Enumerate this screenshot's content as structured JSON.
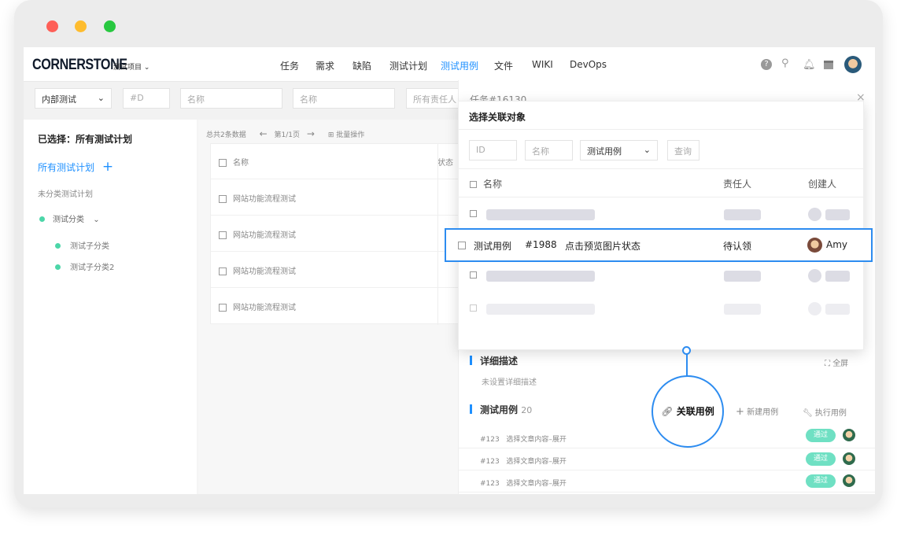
{
  "window": {
    "buttons": [
      "close",
      "minimize",
      "maximize"
    ]
  },
  "nav": {
    "logo": "CORNERSTONE",
    "project": "测试项目",
    "items": [
      "任务",
      "需求",
      "缺陷",
      "测试计划",
      "测试用例",
      "文件",
      "WIKI",
      "DevOps"
    ],
    "active": "测试用例",
    "icons": [
      "help-icon",
      "search-icon",
      "bell-icon",
      "calendar-icon",
      "avatar"
    ]
  },
  "filter": {
    "type": "内部测试",
    "id_placeholder": "#D",
    "name1_placeholder": "名称",
    "name2_placeholder": "名称",
    "owner_placeholder": "所有责任人"
  },
  "sidebar": {
    "selected": "已选择：所有测试计划",
    "all_plans": "所有测试计划",
    "uncategorized": "未分类测试计划",
    "category": "测试分类",
    "subcategories": [
      "测试子分类",
      "测试子分类2"
    ]
  },
  "list": {
    "total": "总共2条数据",
    "page": "第1/1页",
    "batch": "批量操作",
    "col_name": "名称",
    "col_status": "状态",
    "rows": [
      "网站功能流程测试",
      "网站功能流程测试",
      "网站功能流程测试",
      "网站功能流程测试"
    ]
  },
  "task": {
    "title": "任务#16130",
    "desc_title": "详细描述",
    "fullscreen": "全屏",
    "desc_empty": "未设置详细描述",
    "cases_title": "测试用例",
    "cases_count": "20",
    "link_case": "关联用例",
    "new_case": "新建用例",
    "run_case": "执行用例",
    "cases": [
      {
        "id": "#123",
        "name": "选择文章内容–展开",
        "status": "通过"
      },
      {
        "id": "#123",
        "name": "选择文章内容–展开",
        "status": "通过"
      },
      {
        "id": "#123",
        "name": "选择文章内容–展开",
        "status": "通过"
      }
    ]
  },
  "modal": {
    "title": "选择关联对象",
    "id_placeholder": "ID",
    "name_placeholder": "名称",
    "type": "测试用例",
    "query": "查询",
    "col_name": "名称",
    "col_owner": "责任人",
    "col_creator": "创建人",
    "highlight": {
      "type": "测试用例",
      "id": "#1988",
      "name": "点击预览图片状态",
      "owner": "待认领",
      "creator": "Amy"
    }
  },
  "colors": {
    "accent": "#2d8cf0",
    "success": "#6fe0c3",
    "dot": "#4cd6a8"
  }
}
